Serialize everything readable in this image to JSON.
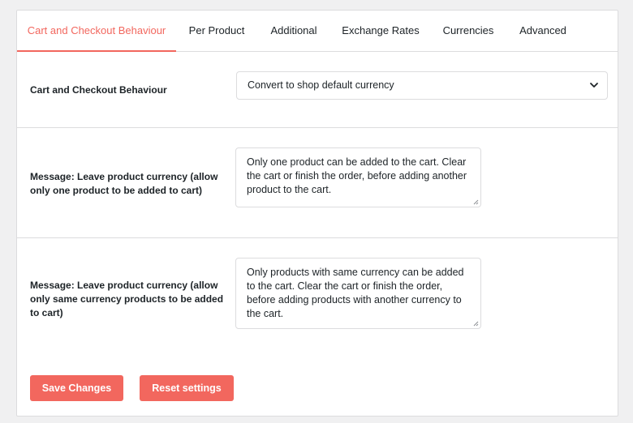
{
  "colors": {
    "accent": "#f2675e",
    "border": "#dcdcde",
    "text": "#1d2327"
  },
  "tabs": [
    {
      "label": "Cart and Checkout Behaviour",
      "active": true
    },
    {
      "label": "Per Product",
      "active": false
    },
    {
      "label": "Additional",
      "active": false
    },
    {
      "label": "Exchange Rates",
      "active": false
    },
    {
      "label": "Currencies",
      "active": false
    },
    {
      "label": "Advanced",
      "active": false
    }
  ],
  "settings": {
    "behaviour": {
      "label": "Cart and Checkout Behaviour",
      "selected": "Convert to shop default currency",
      "icon": "chevron-down-icon"
    },
    "message_one_product": {
      "label": "Message: Leave product currency (allow only one product to be added to cart)",
      "value": "Only one product can be added to the cart. Clear the cart or finish the order, before adding another product to the cart."
    },
    "message_same_currency": {
      "label": "Message: Leave product currency (allow only same currency products to be added to cart)",
      "value": "Only products with same currency can be added to the cart. Clear the cart or finish the order, before adding products with another currency to the cart."
    }
  },
  "actions": {
    "save_label": "Save Changes",
    "reset_label": "Reset settings"
  }
}
